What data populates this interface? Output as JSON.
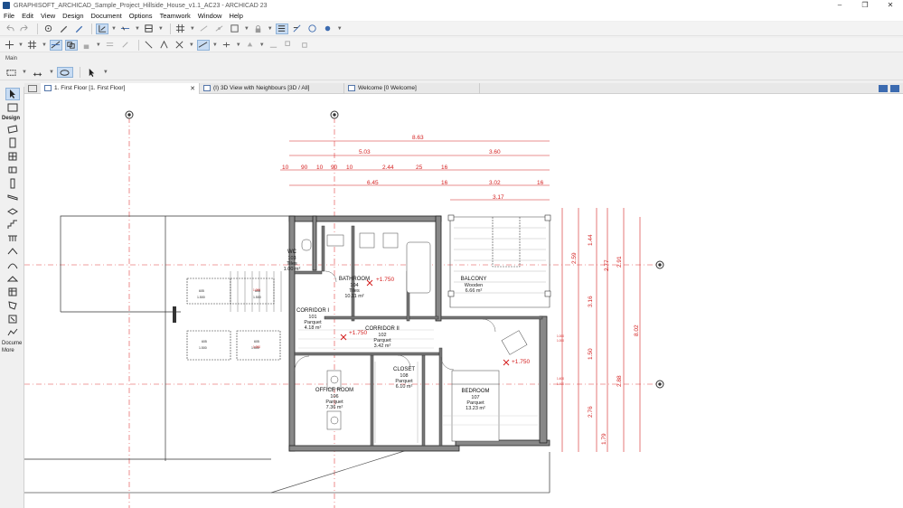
{
  "window": {
    "title": "GRAPHISOFT_ARCHICAD_Sample_Project_Hillside_House_v1.1_AC23 - ARCHICAD 23",
    "controls": [
      "minimize",
      "restore",
      "close"
    ]
  },
  "menu": [
    "File",
    "Edit",
    "View",
    "Design",
    "Document",
    "Options",
    "Teamwork",
    "Window",
    "Help"
  ],
  "toolbar_label": "Main",
  "tabs": [
    {
      "label": "1. First Floor [1. First Floor]",
      "active": true,
      "closable": true
    },
    {
      "label": "(I) 3D View with Neighbours [3D / All]",
      "active": false,
      "closable": false
    },
    {
      "label": "Welcome [0 Welcome]",
      "active": false,
      "closable": false
    }
  ],
  "toolbox": {
    "design_label": "Design",
    "document_label": "Docume",
    "more_label": "More"
  },
  "plan": {
    "dimensions_top": {
      "overall": "8.63",
      "row2": [
        "5.03",
        "3.60"
      ],
      "row3": [
        "10",
        "90",
        "10",
        "90",
        "10",
        "2.44",
        "25",
        "16"
      ],
      "row4": [
        "6.45",
        "16",
        "3.02",
        "16"
      ],
      "row5": [
        "3.17"
      ]
    },
    "dimensions_right": [
      "1.44",
      "2.59",
      "2.77",
      "2.91",
      "3.16",
      "8.02",
      "1.50",
      "2.88",
      "2.76",
      "1.79"
    ],
    "rooms": [
      {
        "name": "WC",
        "num": "103",
        "floor": "Tiles",
        "area": "1.00 m²"
      },
      {
        "name": "BATHROOM",
        "num": "104",
        "floor": "Tiles",
        "area": "10.11 m²"
      },
      {
        "name": "BALCONY",
        "num": "105",
        "floor": "Wooden",
        "area": "6.66 m²"
      },
      {
        "name": "CORRIDOR I",
        "num": "101",
        "floor": "Parquet",
        "area": "4.18 m²"
      },
      {
        "name": "CORRIDOR II",
        "num": "102",
        "floor": "Parquet",
        "area": "3.42 m²"
      },
      {
        "name": "OFFICE ROOM",
        "num": "106",
        "floor": "Parquet",
        "area": "7.36 m²"
      },
      {
        "name": "CLOSET",
        "num": "108",
        "floor": "Parquet",
        "area": "6.10 m²"
      },
      {
        "name": "BEDROOM",
        "num": "107",
        "floor": "Parquet",
        "area": "13.23 m²"
      }
    ],
    "levels": [
      "+1.750",
      "+1.750",
      "+1.750"
    ],
    "stair_labels": [
      "1.500",
      "1.500",
      "1.500",
      "1.500",
      "1.500",
      "1.500"
    ],
    "stair_nums": [
      "605",
      "605",
      "605",
      "605"
    ],
    "small_labels": [
      "1.000",
      "1.000",
      "1.400",
      "1.400",
      "1.000",
      "1.000"
    ]
  },
  "colors": {
    "accent": "#3c6bb0",
    "dimension_red": "#d42020",
    "active_tool": "#c8dcf3"
  }
}
